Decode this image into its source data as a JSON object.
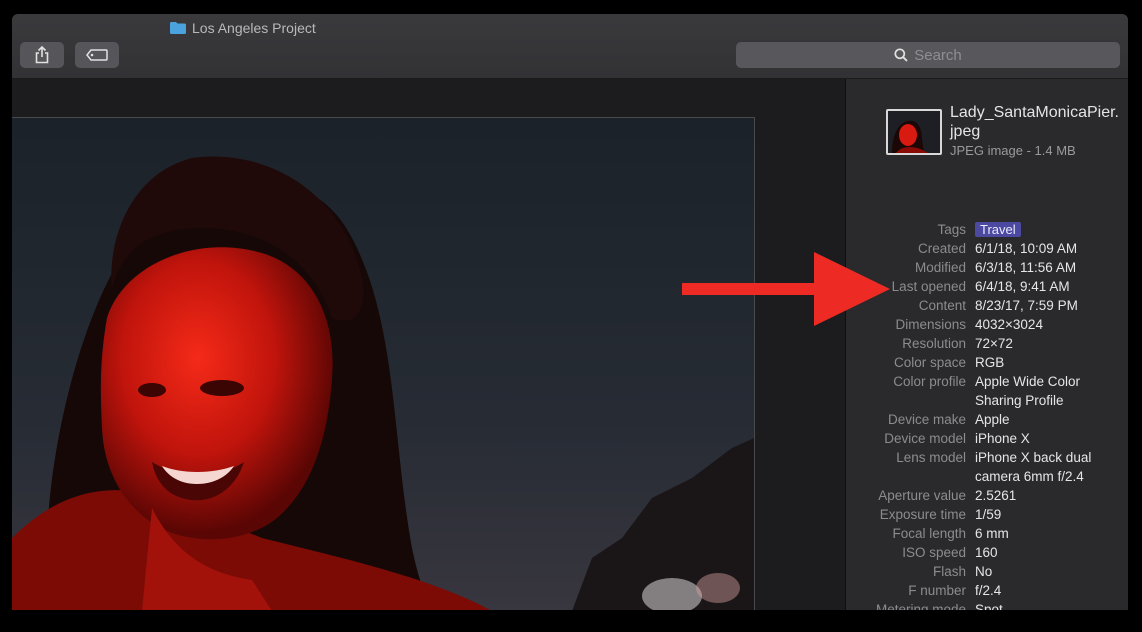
{
  "window": {
    "title": "Los Angeles Project",
    "search_placeholder": "Search"
  },
  "icons": {
    "share": "share-icon",
    "tag": "tag-icon",
    "search": "magnifier-icon",
    "folder": "folder-icon"
  },
  "file": {
    "name": "Lady_SantaMonicaPier.jpeg",
    "type_size": "JPEG image - 1.4 MB"
  },
  "tag": {
    "label": "Tags",
    "value": "Travel",
    "color": "#4b4aa0"
  },
  "metadata": [
    {
      "label": "Created",
      "value": "6/1/18, 10:09 AM"
    },
    {
      "label": "Modified",
      "value": "6/3/18, 11:56 AM"
    },
    {
      "label": "Last opened",
      "value": "6/4/18, 9:41 AM"
    },
    {
      "label": "Content",
      "value": "8/23/17, 7:59 PM"
    },
    {
      "label": "Dimensions",
      "value": "4032×3024"
    },
    {
      "label": "Resolution",
      "value": "72×72"
    },
    {
      "label": "Color space",
      "value": "RGB"
    },
    {
      "label": "Color profile",
      "value": "Apple Wide Color Sharing Profile"
    },
    {
      "label": "Device make",
      "value": "Apple"
    },
    {
      "label": "Device model",
      "value": "iPhone X"
    },
    {
      "label": "Lens model",
      "value": "iPhone X back dual camera 6mm f/2.4"
    },
    {
      "label": "Aperture value",
      "value": "2.5261"
    },
    {
      "label": "Exposure time",
      "value": "1/59"
    },
    {
      "label": "Focal length",
      "value": "6 mm"
    },
    {
      "label": "ISO speed",
      "value": "160"
    },
    {
      "label": "Flash",
      "value": "No"
    },
    {
      "label": "F number",
      "value": "f/2.4"
    },
    {
      "label": "Metering mode",
      "value": "Spot"
    }
  ],
  "annotation": {
    "arrow_color": "#ee2a24"
  }
}
